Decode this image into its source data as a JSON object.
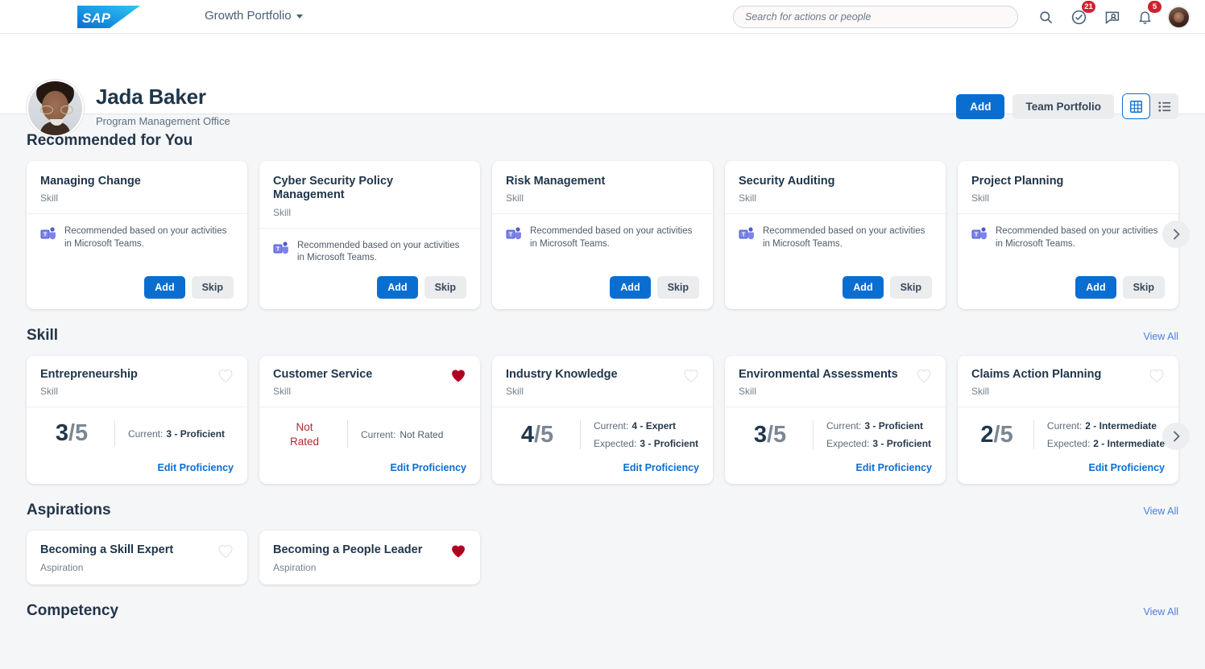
{
  "topnav": {
    "logo_alt": "SAP",
    "portfolio_label": "Growth Portfolio",
    "search_placeholder": "Search for actions or people",
    "icons": [
      {
        "name": "search-icon",
        "badge": ""
      },
      {
        "name": "todo-check-icon",
        "badge": "21"
      },
      {
        "name": "mentor-chat-icon",
        "badge": ""
      },
      {
        "name": "notifications-bell-icon",
        "badge": "5"
      }
    ]
  },
  "profile": {
    "name": "Jada Baker",
    "role": "Program Management Office",
    "add_label": "Add",
    "team_portfolio_label": "Team Portfolio",
    "grid_view_label": "Grid View",
    "list_view_label": "List View"
  },
  "sections": {
    "recommended": {
      "title": "Recommended for You",
      "cards": [
        {
          "title": "Managing Change",
          "subtitle": "Skill",
          "reason": "Recommended based on your activities in Microsoft Teams.",
          "add_label": "Add",
          "skip_label": "Skip"
        },
        {
          "title": "Cyber Security Policy Management",
          "subtitle": "Skill",
          "reason": "Recommended based on your activities in Microsoft Teams.",
          "add_label": "Add",
          "skip_label": "Skip"
        },
        {
          "title": "Risk Management",
          "subtitle": "Skill",
          "reason": "Recommended based on your activities in Microsoft Teams.",
          "add_label": "Add",
          "skip_label": "Skip"
        },
        {
          "title": "Security Auditing",
          "subtitle": "Skill",
          "reason": "Recommended based on your activities in Microsoft Teams.",
          "add_label": "Add",
          "skip_label": "Skip"
        },
        {
          "title": "Project Planning",
          "subtitle": "Skill",
          "reason": "Recommended based on your activities in Microsoft Teams.",
          "add_label": "Add",
          "skip_label": "Skip"
        }
      ]
    },
    "skill": {
      "title": "Skill",
      "view_all": "View All",
      "cards": [
        {
          "title": "Entrepreneurship",
          "subtitle": "Skill",
          "favorite": false,
          "score": "3",
          "score_denominator": "/5",
          "not_rated": false,
          "current_label": "Current:",
          "current_value": "3 - Proficient",
          "expected_label": "",
          "expected_value": "",
          "edit_label": "Edit Proficiency"
        },
        {
          "title": "Customer Service",
          "subtitle": "Skill",
          "favorite": true,
          "score": "Not",
          "score_denominator": "Rated",
          "not_rated": true,
          "current_label": "Current:",
          "current_value": "Not Rated",
          "expected_label": "",
          "expected_value": "",
          "edit_label": "Edit Proficiency"
        },
        {
          "title": "Industry Knowledge",
          "subtitle": "Skill",
          "favorite": false,
          "score": "4",
          "score_denominator": "/5",
          "not_rated": false,
          "current_label": "Current:",
          "current_value": "4 - Expert",
          "expected_label": "Expected:",
          "expected_value": "3 - Proficient",
          "edit_label": "Edit Proficiency"
        },
        {
          "title": "Environmental Assessments",
          "subtitle": "Skill",
          "favorite": false,
          "score": "3",
          "score_denominator": "/5",
          "not_rated": false,
          "current_label": "Current:",
          "current_value": "3 - Proficient",
          "expected_label": "Expected:",
          "expected_value": "3 - Proficient",
          "edit_label": "Edit Proficiency"
        },
        {
          "title": "Claims Action Planning",
          "subtitle": "Skill",
          "favorite": false,
          "score": "2",
          "score_denominator": "/5",
          "not_rated": false,
          "current_label": "Current:",
          "current_value": "2 - Intermediate",
          "expected_label": "Expected:",
          "expected_value": "2 - Intermediate",
          "edit_label": "Edit Proficiency"
        }
      ]
    },
    "aspirations": {
      "title": "Aspirations",
      "view_all": "View All",
      "cards": [
        {
          "title": "Becoming a Skill Expert",
          "subtitle": "Aspiration",
          "favorite": false
        },
        {
          "title": "Becoming a People Leader",
          "subtitle": "Aspiration",
          "favorite": true
        }
      ]
    },
    "competency": {
      "title": "Competency",
      "view_all": "View All"
    }
  },
  "colors": {
    "accent_blue": "#0a6ed1",
    "link_blue": "#4a7fe0",
    "badge_red": "#d32030",
    "heart_red": "#b00020",
    "dark_navy": "#20364b",
    "page_bg": "#f5f6f7"
  }
}
